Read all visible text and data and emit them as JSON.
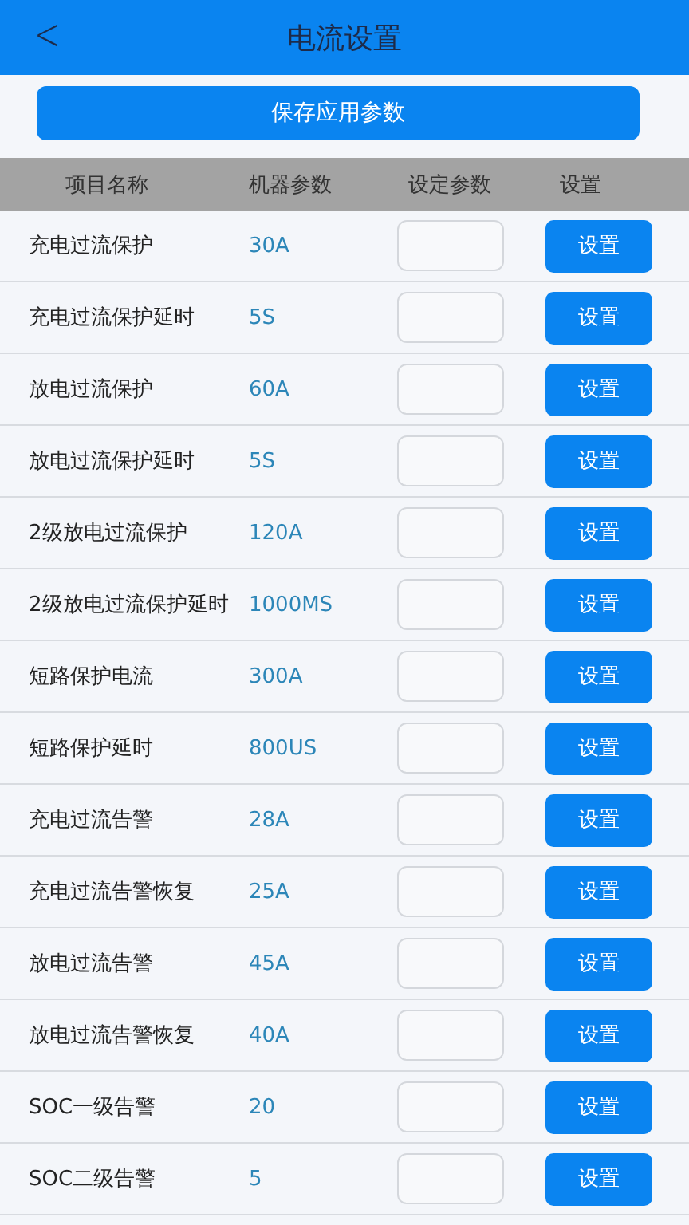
{
  "header": {
    "back": "<",
    "title": "电流设置"
  },
  "save_button": "保存应用参数",
  "table": {
    "columns": [
      "项目名称",
      "机器参数",
      "设定参数",
      "设置"
    ],
    "rows": [
      {
        "name": "充电过流保护",
        "value": "30A",
        "button": "设置"
      },
      {
        "name": "充电过流保护延时",
        "value": "5S",
        "button": "设置"
      },
      {
        "name": "放电过流保护",
        "value": "60A",
        "button": "设置"
      },
      {
        "name": "放电过流保护延时",
        "value": "5S",
        "button": "设置"
      },
      {
        "name": "2级放电过流保护",
        "value": "120A",
        "button": "设置"
      },
      {
        "name": "2级放电过流保护延时",
        "value": "1000MS",
        "button": "设置"
      },
      {
        "name": "短路保护电流",
        "value": "300A",
        "button": "设置"
      },
      {
        "name": "短路保护延时",
        "value": "800US",
        "button": "设置"
      },
      {
        "name": "充电过流告警",
        "value": "28A",
        "button": "设置"
      },
      {
        "name": "充电过流告警恢复",
        "value": "25A",
        "button": "设置"
      },
      {
        "name": "放电过流告警",
        "value": "45A",
        "button": "设置"
      },
      {
        "name": "放电过流告警恢复",
        "value": "40A",
        "button": "设置"
      },
      {
        "name": "SOC一级告警",
        "value": "20",
        "button": "设置"
      },
      {
        "name": "SOC二级告警",
        "value": "5",
        "button": "设置"
      }
    ]
  }
}
